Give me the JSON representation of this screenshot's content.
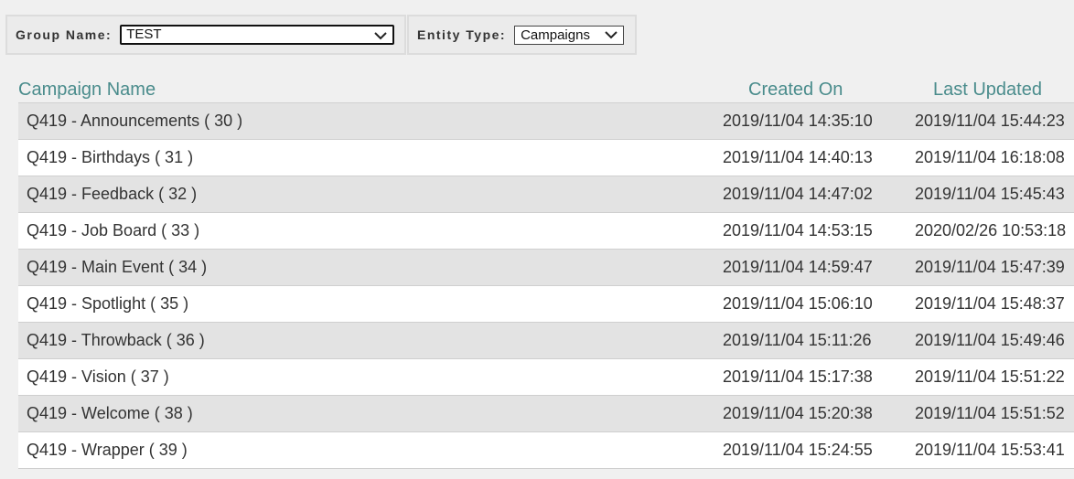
{
  "filters": {
    "group_name_label": "Group Name:",
    "group_name_value": "TEST",
    "entity_type_label": "Entity Type:",
    "entity_type_value": "Campaigns"
  },
  "table": {
    "headers": {
      "name": "Campaign Name",
      "created": "Created On",
      "updated": "Last Updated"
    },
    "rows": [
      {
        "name": "Q419 - Announcements ( 30 )",
        "created": "2019/11/04 14:35:10",
        "updated": "2019/11/04 15:44:23"
      },
      {
        "name": "Q419 - Birthdays ( 31 )",
        "created": "2019/11/04 14:40:13",
        "updated": "2019/11/04 16:18:08"
      },
      {
        "name": "Q419 - Feedback ( 32 )",
        "created": "2019/11/04 14:47:02",
        "updated": "2019/11/04 15:45:43"
      },
      {
        "name": "Q419 - Job Board ( 33 )",
        "created": "2019/11/04 14:53:15",
        "updated": "2020/02/26 10:53:18"
      },
      {
        "name": "Q419 - Main Event ( 34 )",
        "created": "2019/11/04 14:59:47",
        "updated": "2019/11/04 15:47:39"
      },
      {
        "name": "Q419 - Spotlight ( 35 )",
        "created": "2019/11/04 15:06:10",
        "updated": "2019/11/04 15:48:37"
      },
      {
        "name": "Q419 - Throwback ( 36 )",
        "created": "2019/11/04 15:11:26",
        "updated": "2019/11/04 15:49:46"
      },
      {
        "name": "Q419 - Vision ( 37 )",
        "created": "2019/11/04 15:17:38",
        "updated": "2019/11/04 15:51:22"
      },
      {
        "name": "Q419 - Welcome ( 38 )",
        "created": "2019/11/04 15:20:38",
        "updated": "2019/11/04 15:51:52"
      },
      {
        "name": "Q419 - Wrapper ( 39 )",
        "created": "2019/11/04 15:24:55",
        "updated": "2019/11/04 15:53:41"
      }
    ]
  },
  "colors": {
    "header_text": "#4a8c8c",
    "row_alt": "#e3e3e3",
    "row_plain": "#ffffff"
  },
  "icons": {
    "dropdown": "chevron-down-icon"
  }
}
